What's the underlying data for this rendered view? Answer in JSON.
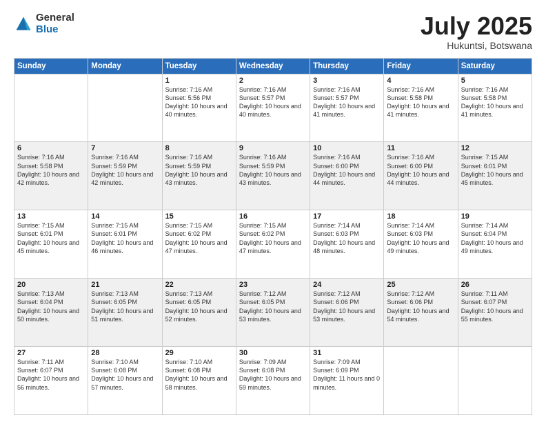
{
  "header": {
    "logo_general": "General",
    "logo_blue": "Blue",
    "month": "July 2025",
    "location": "Hukuntsi, Botswana"
  },
  "days_of_week": [
    "Sunday",
    "Monday",
    "Tuesday",
    "Wednesday",
    "Thursday",
    "Friday",
    "Saturday"
  ],
  "weeks": [
    [
      {
        "day": "",
        "sunrise": "",
        "sunset": "",
        "daylight": ""
      },
      {
        "day": "",
        "sunrise": "",
        "sunset": "",
        "daylight": ""
      },
      {
        "day": "1",
        "sunrise": "Sunrise: 7:16 AM",
        "sunset": "Sunset: 5:56 PM",
        "daylight": "Daylight: 10 hours and 40 minutes."
      },
      {
        "day": "2",
        "sunrise": "Sunrise: 7:16 AM",
        "sunset": "Sunset: 5:57 PM",
        "daylight": "Daylight: 10 hours and 40 minutes."
      },
      {
        "day": "3",
        "sunrise": "Sunrise: 7:16 AM",
        "sunset": "Sunset: 5:57 PM",
        "daylight": "Daylight: 10 hours and 41 minutes."
      },
      {
        "day": "4",
        "sunrise": "Sunrise: 7:16 AM",
        "sunset": "Sunset: 5:58 PM",
        "daylight": "Daylight: 10 hours and 41 minutes."
      },
      {
        "day": "5",
        "sunrise": "Sunrise: 7:16 AM",
        "sunset": "Sunset: 5:58 PM",
        "daylight": "Daylight: 10 hours and 41 minutes."
      }
    ],
    [
      {
        "day": "6",
        "sunrise": "Sunrise: 7:16 AM",
        "sunset": "Sunset: 5:58 PM",
        "daylight": "Daylight: 10 hours and 42 minutes."
      },
      {
        "day": "7",
        "sunrise": "Sunrise: 7:16 AM",
        "sunset": "Sunset: 5:59 PM",
        "daylight": "Daylight: 10 hours and 42 minutes."
      },
      {
        "day": "8",
        "sunrise": "Sunrise: 7:16 AM",
        "sunset": "Sunset: 5:59 PM",
        "daylight": "Daylight: 10 hours and 43 minutes."
      },
      {
        "day": "9",
        "sunrise": "Sunrise: 7:16 AM",
        "sunset": "Sunset: 5:59 PM",
        "daylight": "Daylight: 10 hours and 43 minutes."
      },
      {
        "day": "10",
        "sunrise": "Sunrise: 7:16 AM",
        "sunset": "Sunset: 6:00 PM",
        "daylight": "Daylight: 10 hours and 44 minutes."
      },
      {
        "day": "11",
        "sunrise": "Sunrise: 7:16 AM",
        "sunset": "Sunset: 6:00 PM",
        "daylight": "Daylight: 10 hours and 44 minutes."
      },
      {
        "day": "12",
        "sunrise": "Sunrise: 7:15 AM",
        "sunset": "Sunset: 6:01 PM",
        "daylight": "Daylight: 10 hours and 45 minutes."
      }
    ],
    [
      {
        "day": "13",
        "sunrise": "Sunrise: 7:15 AM",
        "sunset": "Sunset: 6:01 PM",
        "daylight": "Daylight: 10 hours and 45 minutes."
      },
      {
        "day": "14",
        "sunrise": "Sunrise: 7:15 AM",
        "sunset": "Sunset: 6:01 PM",
        "daylight": "Daylight: 10 hours and 46 minutes."
      },
      {
        "day": "15",
        "sunrise": "Sunrise: 7:15 AM",
        "sunset": "Sunset: 6:02 PM",
        "daylight": "Daylight: 10 hours and 47 minutes."
      },
      {
        "day": "16",
        "sunrise": "Sunrise: 7:15 AM",
        "sunset": "Sunset: 6:02 PM",
        "daylight": "Daylight: 10 hours and 47 minutes."
      },
      {
        "day": "17",
        "sunrise": "Sunrise: 7:14 AM",
        "sunset": "Sunset: 6:03 PM",
        "daylight": "Daylight: 10 hours and 48 minutes."
      },
      {
        "day": "18",
        "sunrise": "Sunrise: 7:14 AM",
        "sunset": "Sunset: 6:03 PM",
        "daylight": "Daylight: 10 hours and 49 minutes."
      },
      {
        "day": "19",
        "sunrise": "Sunrise: 7:14 AM",
        "sunset": "Sunset: 6:04 PM",
        "daylight": "Daylight: 10 hours and 49 minutes."
      }
    ],
    [
      {
        "day": "20",
        "sunrise": "Sunrise: 7:13 AM",
        "sunset": "Sunset: 6:04 PM",
        "daylight": "Daylight: 10 hours and 50 minutes."
      },
      {
        "day": "21",
        "sunrise": "Sunrise: 7:13 AM",
        "sunset": "Sunset: 6:05 PM",
        "daylight": "Daylight: 10 hours and 51 minutes."
      },
      {
        "day": "22",
        "sunrise": "Sunrise: 7:13 AM",
        "sunset": "Sunset: 6:05 PM",
        "daylight": "Daylight: 10 hours and 52 minutes."
      },
      {
        "day": "23",
        "sunrise": "Sunrise: 7:12 AM",
        "sunset": "Sunset: 6:05 PM",
        "daylight": "Daylight: 10 hours and 53 minutes."
      },
      {
        "day": "24",
        "sunrise": "Sunrise: 7:12 AM",
        "sunset": "Sunset: 6:06 PM",
        "daylight": "Daylight: 10 hours and 53 minutes."
      },
      {
        "day": "25",
        "sunrise": "Sunrise: 7:12 AM",
        "sunset": "Sunset: 6:06 PM",
        "daylight": "Daylight: 10 hours and 54 minutes."
      },
      {
        "day": "26",
        "sunrise": "Sunrise: 7:11 AM",
        "sunset": "Sunset: 6:07 PM",
        "daylight": "Daylight: 10 hours and 55 minutes."
      }
    ],
    [
      {
        "day": "27",
        "sunrise": "Sunrise: 7:11 AM",
        "sunset": "Sunset: 6:07 PM",
        "daylight": "Daylight: 10 hours and 56 minutes."
      },
      {
        "day": "28",
        "sunrise": "Sunrise: 7:10 AM",
        "sunset": "Sunset: 6:08 PM",
        "daylight": "Daylight: 10 hours and 57 minutes."
      },
      {
        "day": "29",
        "sunrise": "Sunrise: 7:10 AM",
        "sunset": "Sunset: 6:08 PM",
        "daylight": "Daylight: 10 hours and 58 minutes."
      },
      {
        "day": "30",
        "sunrise": "Sunrise: 7:09 AM",
        "sunset": "Sunset: 6:08 PM",
        "daylight": "Daylight: 10 hours and 59 minutes."
      },
      {
        "day": "31",
        "sunrise": "Sunrise: 7:09 AM",
        "sunset": "Sunset: 6:09 PM",
        "daylight": "Daylight: 11 hours and 0 minutes."
      },
      {
        "day": "",
        "sunrise": "",
        "sunset": "",
        "daylight": ""
      },
      {
        "day": "",
        "sunrise": "",
        "sunset": "",
        "daylight": ""
      }
    ]
  ]
}
